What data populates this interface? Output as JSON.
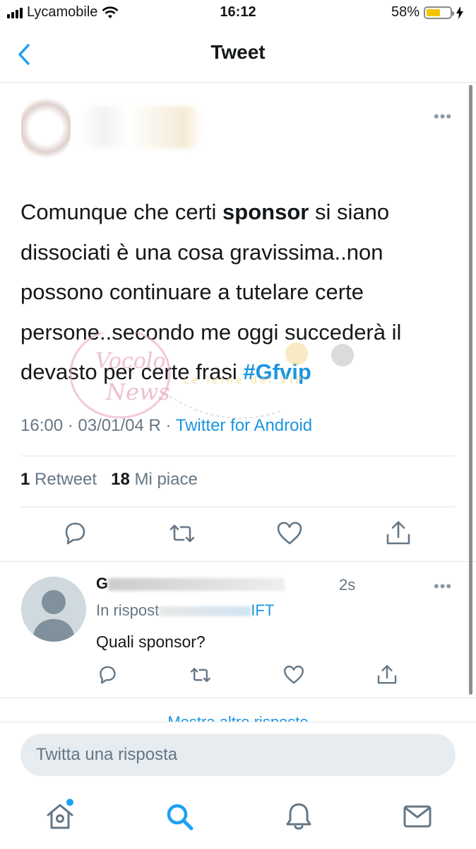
{
  "status_bar": {
    "carrier": "Lycamobile",
    "time": "16:12",
    "battery_percent": "58%",
    "battery_level": 0.58,
    "icons": [
      "signal-icon",
      "wifi-icon",
      "battery-icon",
      "charging-icon"
    ]
  },
  "nav": {
    "title": "Tweet",
    "back_icon": "chevron-left-icon"
  },
  "tweet": {
    "text_before": "Comunque che certi ",
    "text_bold": "sponsor",
    "text_after": " si siano dissociati è una cosa gravissima..non possono continuare a tutelare certe persone..secondo me oggi succederà il devasto per certe frasi ",
    "hashtag": "#Gfvip",
    "time": "16:00",
    "date": "03/01/04 R",
    "separator": "·",
    "source": "Twitter for Android",
    "retweet_count": "1",
    "retweet_label": "Retweet",
    "like_count": "18",
    "like_label": "Mi piace",
    "more_icon": "more-horizontal-icon",
    "actions": [
      "reply-icon",
      "retweet-icon",
      "like-icon",
      "share-icon"
    ]
  },
  "watermark": {
    "text_1": "Vocolo",
    "text_2": "News",
    "text_3": "Le leine dei VIP"
  },
  "reply": {
    "name_visible": "G",
    "time": "2s",
    "in_reply_label": "In rispost",
    "handle_visible": "IFT",
    "text": "Quali sponsor?",
    "actions": [
      "reply-icon",
      "retweet-icon",
      "like-icon",
      "share-icon"
    ]
  },
  "more_replies": {
    "label": "Mostra altre risposte"
  },
  "compose": {
    "placeholder": "Twitta una risposta"
  },
  "tab_bar": {
    "tabs": [
      "home-icon",
      "search-icon",
      "notifications-icon",
      "messages-icon"
    ],
    "active": "search-icon",
    "accent": "#1da1f2"
  },
  "colors": {
    "accent": "#1da1f2",
    "link": "#1b95e0",
    "secondary_text": "#657786",
    "divider": "#e1e8ed"
  }
}
